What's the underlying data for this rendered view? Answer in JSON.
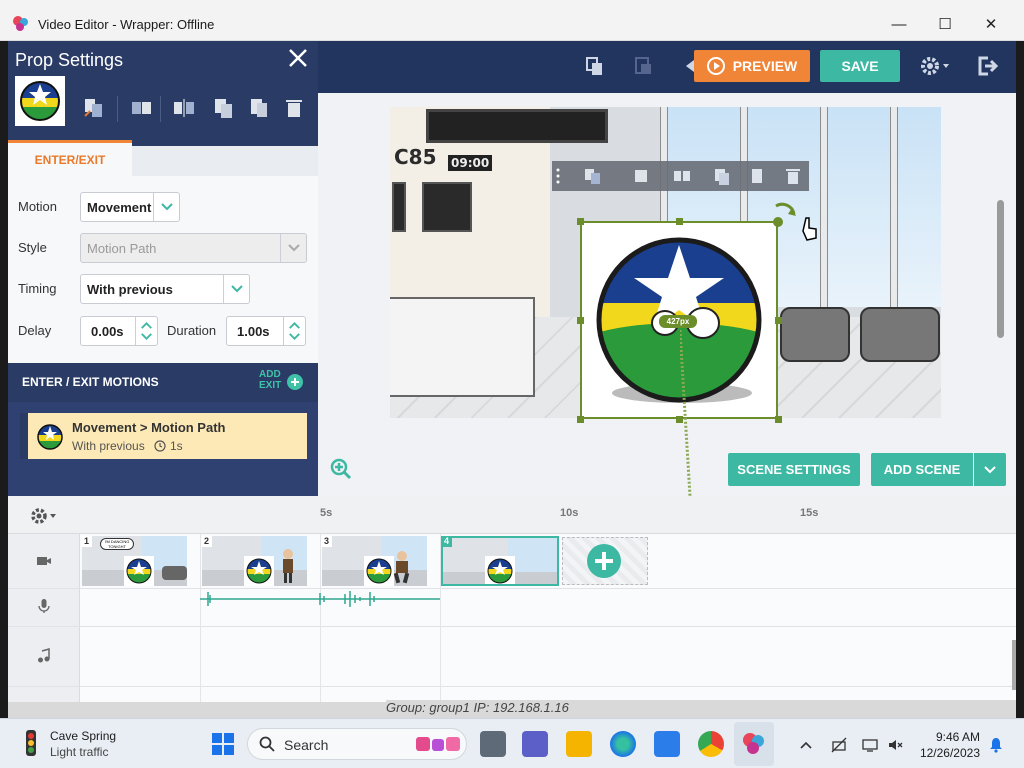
{
  "window": {
    "title": "Video Editor - Wrapper: Offline",
    "minimize": "—",
    "maximize": "☐",
    "close": "✕"
  },
  "toolbar": {
    "preview_label": "PREVIEW",
    "save_label": "SAVE"
  },
  "prop_settings": {
    "title": "Prop Settings",
    "tab_active": "ENTER/EXIT",
    "form": {
      "motion_label": "Motion",
      "motion_value": "Movement",
      "style_label": "Style",
      "style_value": "Motion Path",
      "timing_label": "Timing",
      "timing_value": "With previous",
      "delay_label": "Delay",
      "delay_value": "0.00s",
      "duration_label": "Duration",
      "duration_value": "1.00s"
    },
    "motions_header": "ENTER / EXIT MOTIONS",
    "add_exit_line1": "ADD",
    "add_exit_line2": "EXIT",
    "motion_item": {
      "title": "Movement > Motion Path",
      "timing": "With previous",
      "duration": "1s"
    }
  },
  "stage": {
    "board_text": "C85",
    "board_time": "09:00",
    "size_badge": "427px"
  },
  "scene_buttons": {
    "scene_settings": "SCENE SETTINGS",
    "add_scene": "ADD SCENE"
  },
  "timeline": {
    "ticks": [
      "5s",
      "10s",
      "15s"
    ],
    "scenes": [
      "1",
      "2",
      "3",
      "4"
    ],
    "bubble_text": "I'M DANCING TONIGHT"
  },
  "behind_text": "Group: group1   IP: 192.168.1.16",
  "taskbar": {
    "weather_place": "Cave Spring",
    "weather_status": "Light traffic",
    "search_label": "Search",
    "time": "9:46 AM",
    "date": "12/26/2023"
  },
  "colors": {
    "panel": "#2a3b66",
    "accent_orange": "#f08437",
    "accent_teal": "#3db8a3",
    "selection_green": "#6c8e2a"
  }
}
